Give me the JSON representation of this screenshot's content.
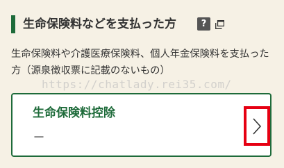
{
  "section": {
    "title": "生命保険料などを支払った方",
    "help_label": "?",
    "description": "生命保険料や介護医療保険料、個人年金保険料を支払った方（源泉徴収票に記載のないもの）"
  },
  "watermark_text": "https://chatlady.rei35.com/",
  "card": {
    "title": "生命保険料控除",
    "value": "－"
  },
  "colors": {
    "accent": "#1e6b3a",
    "highlight": "#e60012",
    "background": "#f6f1e5"
  }
}
